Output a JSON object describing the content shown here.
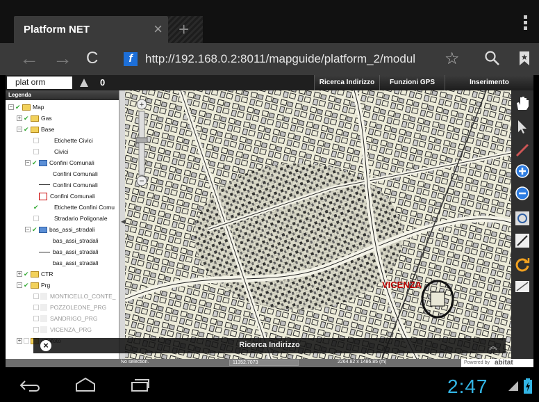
{
  "browser": {
    "tab_title": "Platform NET",
    "tab_close": "×",
    "new_tab": "+",
    "url": "http://192.168.0.2:8011/mapguide/platform_2/modul",
    "url_icon": "f"
  },
  "app": {
    "logo_text": "plat orm",
    "counter": "0",
    "top_buttons": [
      "Ricerca Indirizzo",
      "Funzioni GPS",
      "Inserimento"
    ]
  },
  "legend": {
    "title": "Legenda",
    "items": [
      {
        "label": "Map",
        "level": 0
      },
      {
        "label": "Gas",
        "level": 1
      },
      {
        "label": "Base",
        "level": 1
      },
      {
        "label": "Etichette Civici",
        "level": 2
      },
      {
        "label": "Civici",
        "level": 2
      },
      {
        "label": "Confini Comunali",
        "level": 2
      },
      {
        "label": "Confini Comunali",
        "level": 3
      },
      {
        "label": "Confini Comunali",
        "level": 3
      },
      {
        "label": "Confini Comunali",
        "level": 3
      },
      {
        "label": "Etichette Confini Comu",
        "level": 2
      },
      {
        "label": "Stradario Poligonale",
        "level": 2
      },
      {
        "label": "bas_assi_stradali",
        "level": 2
      },
      {
        "label": "bas_assi_stradali",
        "level": 3
      },
      {
        "label": "bas_assi_stradali",
        "level": 3
      },
      {
        "label": "bas_assi_stradali",
        "level": 3
      },
      {
        "label": "CTR",
        "level": 1
      },
      {
        "label": "Prg",
        "level": 1
      },
      {
        "label": "MONTICELLO_CONTE_",
        "level": 2
      },
      {
        "label": "POZZOLEONE_PRG",
        "level": 2
      },
      {
        "label": "SANDRIGO_PRG",
        "level": 2
      },
      {
        "label": "VICENZA_PRG",
        "level": 2
      },
      {
        "label": "ortofoto",
        "level": 1
      }
    ]
  },
  "map": {
    "city_label": "VICENZA"
  },
  "search_panel": {
    "title": "Ricerca Indirizzo",
    "close": "×"
  },
  "status": {
    "selection": "No selection.",
    "scale": "11352.7073",
    "extent": "2264.82 x 1486.85 (m)",
    "powered_by": "Powered by",
    "brand": "abitat"
  },
  "system": {
    "clock": "2:47"
  }
}
